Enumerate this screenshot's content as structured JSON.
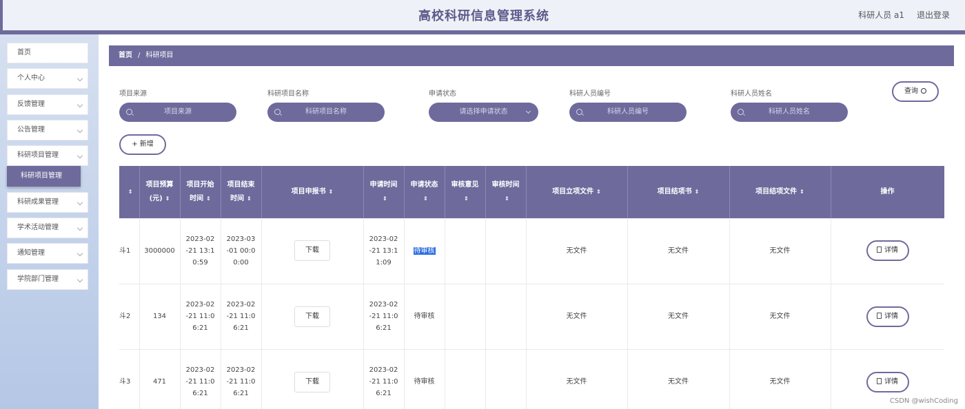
{
  "header": {
    "title": "高校科研信息管理系统",
    "user": "科研人员 a1",
    "logout": "退出登录"
  },
  "sidebar": {
    "items": [
      {
        "label": "首页"
      },
      {
        "label": "个人中心"
      },
      {
        "label": "反馈管理"
      },
      {
        "label": "公告管理"
      },
      {
        "label": "科研项目管理"
      },
      {
        "label": "科研成果管理"
      },
      {
        "label": "学术活动管理"
      },
      {
        "label": "通知管理"
      },
      {
        "label": "学院部门管理"
      }
    ],
    "active_sub": "科研项目管理"
  },
  "breadcrumb": {
    "home": "首页",
    "separator": "/",
    "current": "科研项目"
  },
  "search": {
    "fields": [
      {
        "label": "项目来源",
        "placeholder": "项目来源"
      },
      {
        "label": "科研项目名称",
        "placeholder": "科研项目名称"
      },
      {
        "label": "申请状态",
        "placeholder": "请选择申请状态"
      },
      {
        "label": "科研人员编号",
        "placeholder": "科研人员编号"
      },
      {
        "label": "科研人员姓名",
        "placeholder": "科研人员姓名"
      }
    ],
    "query_label": "查询",
    "add_label": "+ 新增"
  },
  "table": {
    "sort_glyph": "⇕",
    "headers": {
      "c0": "",
      "c1a": "项目预算",
      "c1b": "(元)",
      "c2a": "项目开始",
      "c2b": "时间",
      "c3a": "项目结束",
      "c3b": "时间",
      "c4": "项目申报书",
      "c5": "申请时间",
      "c6": "申请状态",
      "c7": "审核意见",
      "c8": "审核时间",
      "c9": "项目立项文件",
      "c10": "项目结项书",
      "c11": "项目结项文件",
      "c12": "操作"
    },
    "rows": [
      {
        "c0": "斗1",
        "budget": "3000000",
        "start_a": "2023-02",
        "start_b": "-21 13:1",
        "start_c": "0:59",
        "end_a": "2023-03",
        "end_b": "-01 00:0",
        "end_c": "0:00",
        "download": "下载",
        "apply_a": "2023-02",
        "apply_b": "-21 13:1",
        "apply_c": "1:09",
        "status": "待审核",
        "opinion": "",
        "audit_time": "",
        "lixiang": "无文件",
        "jiexiang_shu": "无文件",
        "jiexiang_file": "无文件",
        "detail": "详情"
      },
      {
        "c0": "斗2",
        "budget": "134",
        "start_a": "2023-02",
        "start_b": "-21 11:0",
        "start_c": "6:21",
        "end_a": "2023-02",
        "end_b": "-21 11:0",
        "end_c": "6:21",
        "download": "下载",
        "apply_a": "2023-02",
        "apply_b": "-21 11:0",
        "apply_c": "6:21",
        "status": "待审核",
        "opinion": "",
        "audit_time": "",
        "lixiang": "无文件",
        "jiexiang_shu": "无文件",
        "jiexiang_file": "无文件",
        "detail": "详情"
      },
      {
        "c0": "斗3",
        "budget": "471",
        "start_a": "2023-02",
        "start_b": "-21 11:0",
        "start_c": "6:21",
        "end_a": "2023-02",
        "end_b": "-21 11:0",
        "end_c": "6:21",
        "download": "下载",
        "apply_a": "2023-02",
        "apply_b": "-21 11:0",
        "apply_c": "6:21",
        "status": "待审核",
        "opinion": "",
        "audit_time": "",
        "lixiang": "无文件",
        "jiexiang_shu": "无文件",
        "jiexiang_file": "无文件",
        "detail": "详情"
      }
    ]
  },
  "watermark": "CSDN @wishCoding"
}
